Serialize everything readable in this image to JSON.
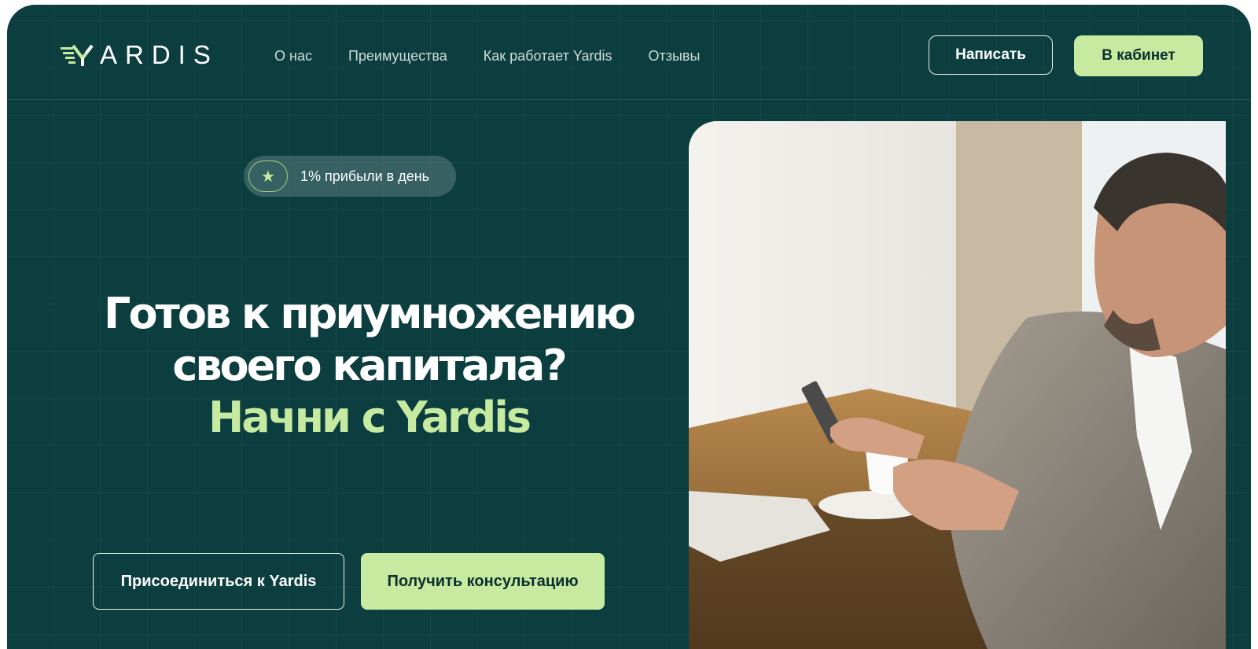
{
  "brand": {
    "name": "ARDIS",
    "logo_icon": "yardis-logo-icon"
  },
  "nav": {
    "items": [
      {
        "label": "О нас"
      },
      {
        "label": "Преимущества"
      },
      {
        "label": "Как работает Yardis"
      },
      {
        "label": "Отзывы"
      }
    ]
  },
  "header_actions": {
    "write_label": "Написать",
    "cabinet_label": "В кабинет"
  },
  "badge": {
    "icon": "star-icon",
    "text": "1% прибыли в день"
  },
  "hero": {
    "line1": "Готов к приумножению",
    "line2": "своего капитала?",
    "accent": "Начни с Yardis"
  },
  "cta": {
    "join_label": "Присоединиться к Yardis",
    "consult_label": "Получить консультацию"
  },
  "colors": {
    "background": "#0c3e40",
    "accent": "#c6eaa0",
    "text": "#ffffff"
  }
}
